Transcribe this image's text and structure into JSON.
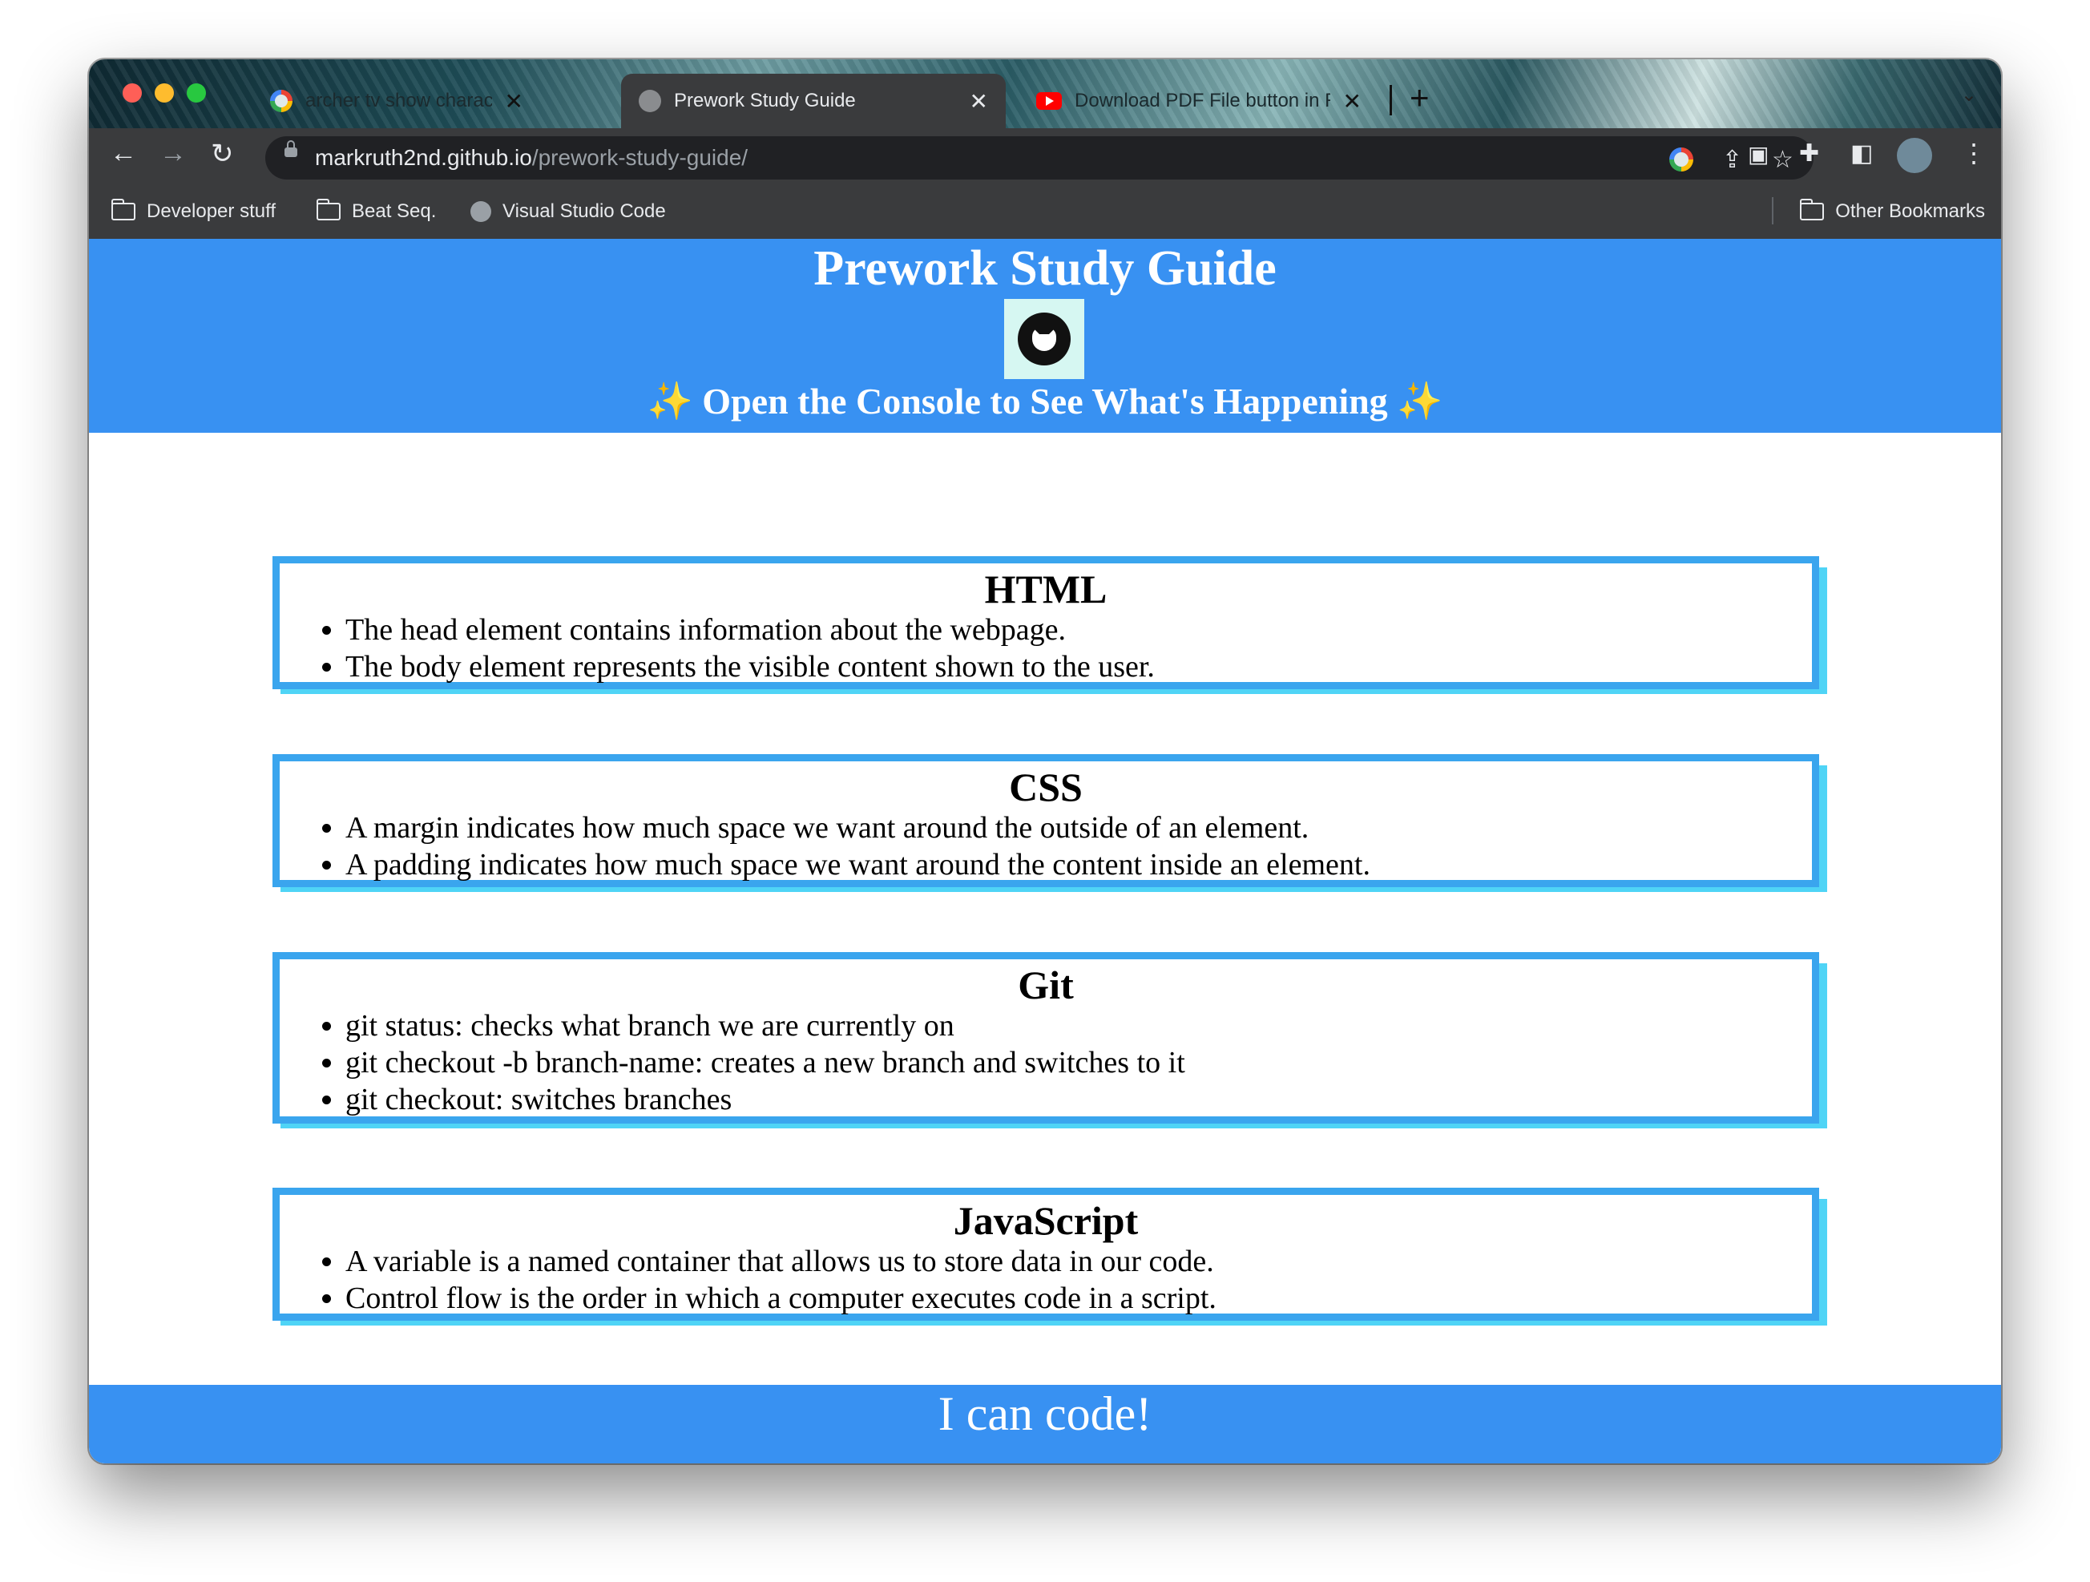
{
  "browser": {
    "tabs": [
      {
        "title": "archer tv show characters png",
        "favicon": "google-icon",
        "active": false
      },
      {
        "title": "Prework Study Guide",
        "favicon": "globe-icon",
        "active": true
      },
      {
        "title": "Download PDF File button in R",
        "favicon": "youtube-icon",
        "active": false
      }
    ],
    "url_host": "markruth2nd.github.io",
    "url_path": "/prework-study-guide/",
    "bookmarks": [
      {
        "label": "Developer stuff",
        "icon": "folder-icon"
      },
      {
        "label": "Beat Seq.",
        "icon": "folder-icon"
      },
      {
        "label": "Visual Studio Code",
        "icon": "globe-icon"
      }
    ],
    "other_bookmarks": "Other Bookmarks"
  },
  "page": {
    "title": "Prework Study Guide",
    "subtitle": "Open the Console to See What's Happening",
    "sparkle": "✨",
    "sections": [
      {
        "heading": "HTML",
        "items": [
          "The head element contains information about the webpage.",
          "The body element represents the visible content shown to the user."
        ]
      },
      {
        "heading": "CSS",
        "items": [
          "A margin indicates how much space we want around the outside of an element.",
          "A padding indicates how much space we want around the content inside an element."
        ]
      },
      {
        "heading": "Git",
        "items": [
          "git status: checks what branch we are currently on",
          "git checkout -b branch-name: creates a new branch and switches to it",
          "git checkout: switches branches"
        ]
      },
      {
        "heading": "JavaScript",
        "items": [
          "A variable is a named container that allows us to store data in our code.",
          "Control flow is the order in which a computer executes code in a script."
        ]
      }
    ],
    "footer": "I can code!"
  },
  "colors": {
    "header_bg": "#3891f2",
    "card_border": "#3aa5ee",
    "card_shadow": "#4fd4f6"
  }
}
